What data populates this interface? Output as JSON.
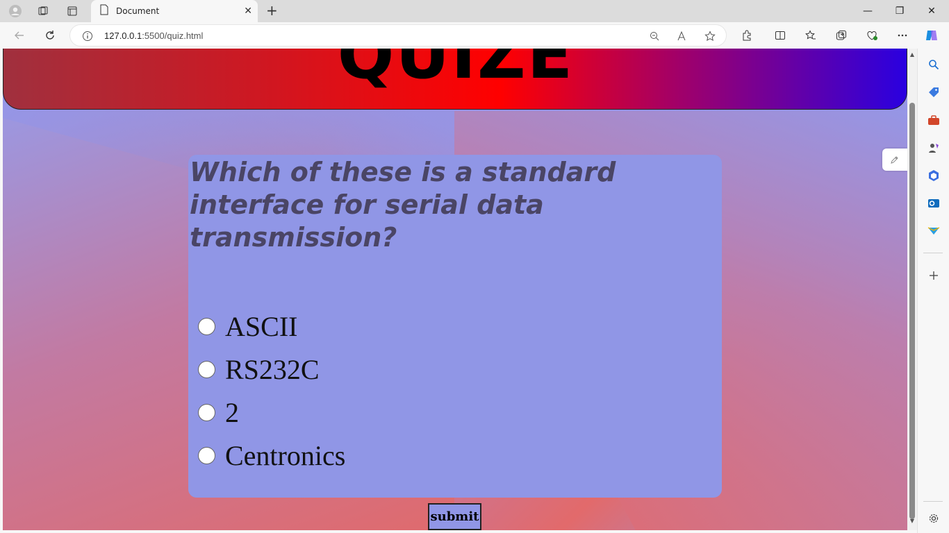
{
  "browser": {
    "tab": {
      "title": "Document",
      "close": "✕"
    },
    "new_tab": "+",
    "window_controls": {
      "minimize": "—",
      "restore": "❐",
      "close": "✕"
    },
    "address": {
      "host": "127.0.0.1",
      "path": ":5500/quiz.html"
    }
  },
  "page": {
    "header_title": "QUIZE",
    "question": "Which of these is a standard interface for serial data transmission?",
    "options": [
      {
        "label": "ASCII",
        "checked": false
      },
      {
        "label": "RS232C",
        "checked": false
      },
      {
        "label": "2",
        "checked": false
      },
      {
        "label": "Centronics",
        "checked": false
      }
    ],
    "submit_label": "submit"
  },
  "colors": {
    "card": "#9096e6",
    "question_text": "#4a4565",
    "banner_start": "#a0303e",
    "banner_mid": "#ff0000",
    "banner_end": "#2a00e0"
  }
}
